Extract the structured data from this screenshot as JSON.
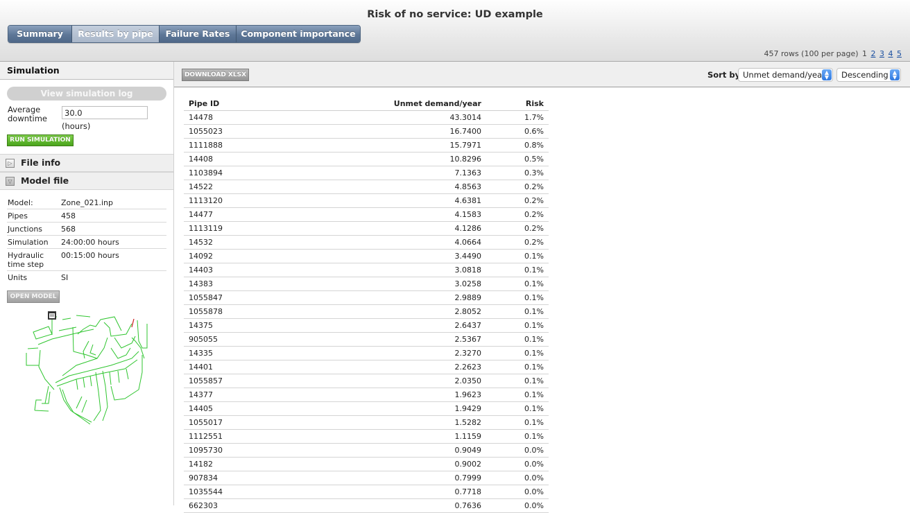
{
  "header": {
    "title": "Risk of no service: UD example",
    "tabs": [
      {
        "label": "Summary",
        "active": false
      },
      {
        "label": "Results by pipe",
        "active": true
      },
      {
        "label": "Failure Rates",
        "active": false
      },
      {
        "label": "Component importance",
        "active": false
      }
    ],
    "pager": {
      "summary": "457 rows (100 per page)",
      "current_page": "1",
      "pages": [
        "2",
        "3",
        "4",
        "5"
      ]
    }
  },
  "sidebar": {
    "simulation": {
      "title": "Simulation",
      "view_log_label": "View simulation log",
      "avg_downtime_label": "Average downtime",
      "avg_downtime_value": "30.0",
      "avg_downtime_unit": "(hours)",
      "run_label": "RUN SIMULATION"
    },
    "file_info": {
      "title": "File info",
      "expanded": false,
      "icon": "triangle-right-icon"
    },
    "model_file": {
      "title": "Model file",
      "expanded": true,
      "icon": "triangle-down-icon",
      "rows": [
        {
          "key": "Model:",
          "value": "Zone_021.inp"
        },
        {
          "key": "Pipes",
          "value": "458"
        },
        {
          "key": "Junctions",
          "value": "568"
        },
        {
          "key": "Simulation",
          "value": "24:00:00 hours"
        },
        {
          "key": "Hydraulic time step",
          "value": "00:15:00 hours"
        },
        {
          "key": "Units",
          "value": "SI"
        }
      ],
      "open_label": "OPEN MODEL"
    },
    "network_map": {
      "pipe_color": "#2ec52e",
      "highlight_color": "#cc1f1f"
    }
  },
  "toolbar": {
    "download_label": "DOWNLOAD XLSX",
    "sort_by_label": "Sort by",
    "sort_field": "Unmet demand/year",
    "sort_order": "Descending"
  },
  "results": {
    "columns": [
      "Pipe ID",
      "Unmet demand/year",
      "Risk"
    ],
    "rows": [
      [
        "14478",
        "43.3014",
        "1.7%"
      ],
      [
        "1055023",
        "16.7400",
        "0.6%"
      ],
      [
        "1111888",
        "15.7971",
        "0.8%"
      ],
      [
        "14408",
        "10.8296",
        "0.5%"
      ],
      [
        "1103894",
        "7.1363",
        "0.3%"
      ],
      [
        "14522",
        "4.8563",
        "0.2%"
      ],
      [
        "1113120",
        "4.6381",
        "0.2%"
      ],
      [
        "14477",
        "4.1583",
        "0.2%"
      ],
      [
        "1113119",
        "4.1286",
        "0.2%"
      ],
      [
        "14532",
        "4.0664",
        "0.2%"
      ],
      [
        "14092",
        "3.4490",
        "0.1%"
      ],
      [
        "14403",
        "3.0818",
        "0.1%"
      ],
      [
        "14383",
        "3.0258",
        "0.1%"
      ],
      [
        "1055847",
        "2.9889",
        "0.1%"
      ],
      [
        "1055878",
        "2.8052",
        "0.1%"
      ],
      [
        "14375",
        "2.6437",
        "0.1%"
      ],
      [
        "905055",
        "2.5367",
        "0.1%"
      ],
      [
        "14335",
        "2.3270",
        "0.1%"
      ],
      [
        "14401",
        "2.2623",
        "0.1%"
      ],
      [
        "1055857",
        "2.0350",
        "0.1%"
      ],
      [
        "14377",
        "1.9623",
        "0.1%"
      ],
      [
        "14405",
        "1.9429",
        "0.1%"
      ],
      [
        "1055017",
        "1.5282",
        "0.1%"
      ],
      [
        "1112551",
        "1.1159",
        "0.1%"
      ],
      [
        "1095730",
        "0.9049",
        "0.0%"
      ],
      [
        "14182",
        "0.9002",
        "0.0%"
      ],
      [
        "907834",
        "0.7999",
        "0.0%"
      ],
      [
        "1035544",
        "0.7718",
        "0.0%"
      ],
      [
        "662303",
        "0.7636",
        "0.0%"
      ]
    ]
  }
}
